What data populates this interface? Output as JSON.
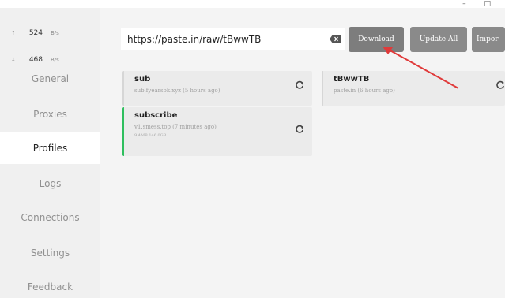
{
  "window": {
    "controls": [
      "–",
      "□"
    ]
  },
  "traffic": {
    "up": {
      "arrow": "↑",
      "value": "524",
      "unit": "B/s"
    },
    "down": {
      "arrow": "↓",
      "value": "468",
      "unit": "B/s"
    }
  },
  "sidebar": {
    "items": [
      {
        "label": "General",
        "active": false
      },
      {
        "label": "Proxies",
        "active": false
      },
      {
        "label": "Profiles",
        "active": true
      },
      {
        "label": "Logs",
        "active": false
      },
      {
        "label": "Connections",
        "active": false
      },
      {
        "label": "Settings",
        "active": false
      },
      {
        "label": "Feedback",
        "active": false
      }
    ]
  },
  "toolbar": {
    "url_value": "https://paste.in/raw/tBwwTB",
    "clear_icon": "backspace-icon",
    "download_label": "Download",
    "update_all_label": "Update All",
    "import_label": "Impor"
  },
  "profiles": [
    {
      "name": "sub",
      "meta": "sub.fyearsok.xyz (5 hours ago)",
      "extra": "",
      "selected": false
    },
    {
      "name": "tBwwTB",
      "meta": "paste.in (6 hours ago)",
      "extra": "",
      "selected": false
    },
    {
      "name": "subscribe",
      "meta": "v1.smess.top (7 minutes ago)",
      "extra": "9.4MB  146.0GB",
      "selected": true
    }
  ],
  "colors": {
    "active_border": "#2fbf5e",
    "annotation_arrow": "#e03a3a",
    "button_bg": "#8a8a8a"
  }
}
